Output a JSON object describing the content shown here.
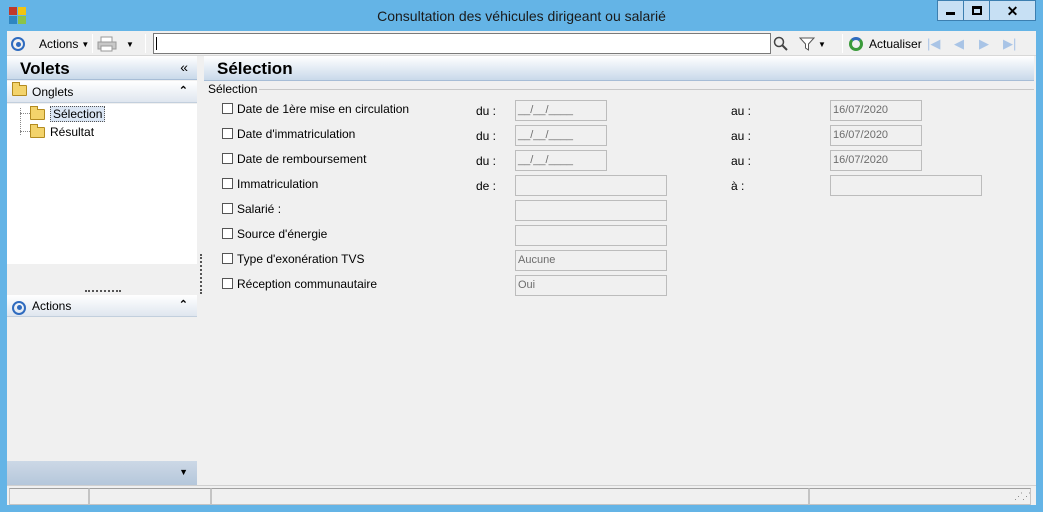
{
  "window": {
    "title": "Consultation des véhicules dirigeant ou salarié",
    "icon": "app-color-squares-icon"
  },
  "toolbar": {
    "actions_label": "Actions",
    "search_value": "",
    "refresh_label": "Actualiser"
  },
  "left_pane": {
    "title": "Volets",
    "collapse_glyph": "«",
    "onglets_group": "Onglets",
    "tree": [
      {
        "label": "Sélection",
        "selected": true
      },
      {
        "label": "Résultat",
        "selected": false
      }
    ],
    "actions_group": "Actions"
  },
  "main": {
    "title": "Sélection",
    "groupbox_label": "Sélection",
    "rows": [
      {
        "label": "Date de 1ère mise en circulation",
        "from_label": "du :",
        "from_value": "__/__/____",
        "to_label": "au :",
        "to_value": "16/07/2020"
      },
      {
        "label": "Date d'immatriculation",
        "from_label": "du :",
        "from_value": "__/__/____",
        "to_label": "au :",
        "to_value": "16/07/2020"
      },
      {
        "label": "Date de remboursement",
        "from_label": "du :",
        "from_value": "__/__/____",
        "to_label": "au :",
        "to_value": "16/07/2020"
      },
      {
        "label": "Immatriculation",
        "from_label": "de :",
        "from_value": "",
        "to_label": "à :",
        "to_value": ""
      },
      {
        "label": "Salarié :",
        "value": ""
      },
      {
        "label": "Source d'énergie",
        "value": ""
      },
      {
        "label": "Type d'exonération TVS",
        "value": "Aucune"
      },
      {
        "label": "Réception communautaire",
        "value": "Oui"
      }
    ]
  }
}
